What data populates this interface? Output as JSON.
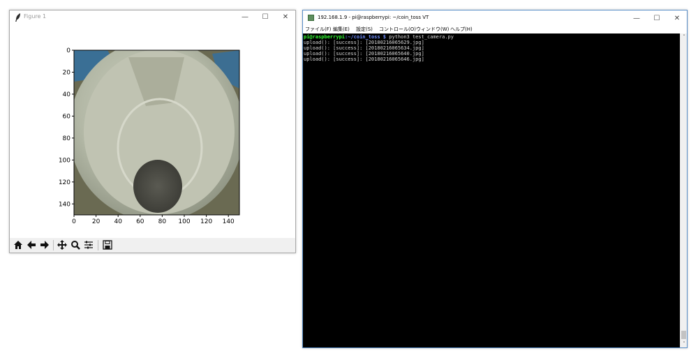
{
  "figure_window": {
    "title": "Figure 1",
    "minimize_symbol": "—",
    "maximize_symbol": "☐",
    "close_symbol": "✕",
    "plot": {
      "x_ticks": [
        "0",
        "20",
        "40",
        "60",
        "80",
        "100",
        "120",
        "140"
      ],
      "y_ticks": [
        "0",
        "20",
        "40",
        "60",
        "80",
        "100",
        "120",
        "140"
      ],
      "x_range": [
        0,
        150
      ],
      "y_range": [
        0,
        150
      ]
    },
    "toolbar_icons": [
      "home-icon",
      "back-arrow-icon",
      "forward-arrow-icon",
      "pan-icon",
      "zoom-icon",
      "configure-subplots-icon",
      "save-icon"
    ]
  },
  "terminal_window": {
    "title": "192.168.1.9 - pi@raspberrypi: ~/coin_toss VT",
    "minimize_symbol": "—",
    "maximize_symbol": "☐",
    "close_symbol": "✕",
    "menu": [
      "ファイル(F)",
      "編集(E)",
      "設定(S)",
      "コントロール(O)",
      "ウィンドウ(W)",
      "ヘルプ(H)"
    ],
    "prompt": {
      "user": "pi@raspberrypi",
      "path": ":~/coin_toss $",
      "command": " python3 test_camera.py"
    },
    "output_lines": [
      "upload(): [success]: [20180216065629.jpg]",
      "upload(): [success]: [20180216065634.jpg]",
      "upload(): [success]: [20180216065640.jpg]",
      "upload(): [success]: [20180216065646.jpg]"
    ],
    "scroll_up_symbol": "˄",
    "scroll_down_symbol": "˅"
  },
  "colors": {
    "terminal_background": "#000000",
    "prompt_user": "#33ff33",
    "prompt_path": "#6f8fff",
    "terminal_text": "#d8d8d8"
  }
}
